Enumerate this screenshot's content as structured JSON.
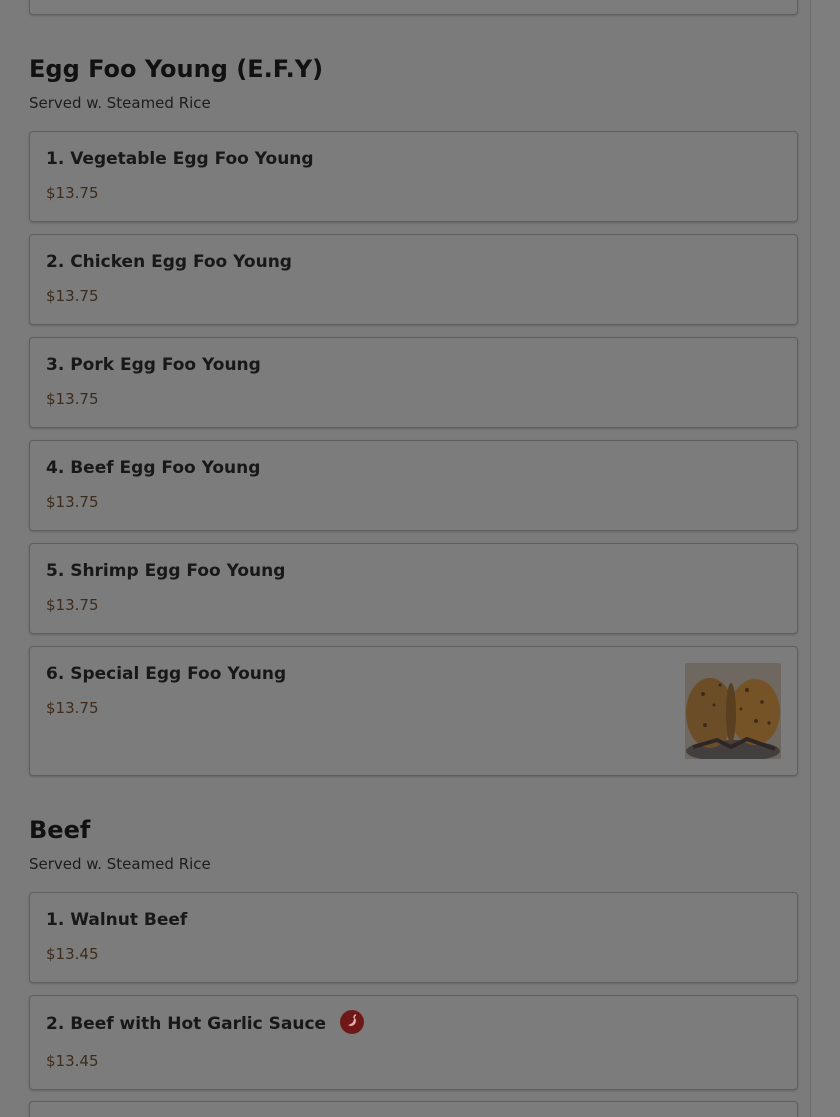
{
  "sections": [
    {
      "title": "Egg Foo Young (E.F.Y)",
      "subtitle": "Served w. Steamed Rice",
      "items": [
        {
          "name": "1. Vegetable Egg Foo Young",
          "price": "$13.75"
        },
        {
          "name": "2. Chicken Egg Foo Young",
          "price": "$13.75"
        },
        {
          "name": "3. Pork Egg Foo Young",
          "price": "$13.75"
        },
        {
          "name": "4. Beef Egg Foo Young",
          "price": "$13.75"
        },
        {
          "name": "5. Shrimp Egg Foo Young",
          "price": "$13.75"
        },
        {
          "name": "6. Special Egg Foo Young",
          "price": "$13.75",
          "image": "egg-foo-young-photo"
        }
      ]
    },
    {
      "title": "Beef",
      "subtitle": "Served w. Steamed Rice",
      "items": [
        {
          "name": "1. Walnut Beef",
          "price": "$13.45"
        },
        {
          "name": "2. Beef with Hot Garlic Sauce",
          "price": "$13.45",
          "icon": "spicy-pepper-icon"
        }
      ]
    }
  ],
  "colors": {
    "overlay_background": "#7b7b7b",
    "title_text": "#181818",
    "price_text": "#3d2c1b",
    "spicy_badge": "#6f1818"
  }
}
